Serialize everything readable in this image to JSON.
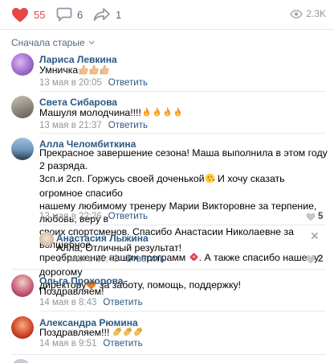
{
  "post_actions": {
    "likes": "55",
    "comments": "6",
    "shares": "1",
    "views": "2.3K"
  },
  "sort_label": "Сначала старые",
  "comments": [
    {
      "author": "Лариса Левкина",
      "text": "Умничка",
      "emoji": [
        "thumbs-up",
        "thumbs-up",
        "thumbs-up"
      ],
      "date": "13 мая в 20:05",
      "reply": "Ответить"
    },
    {
      "author": "Света Сибарова",
      "text": "Машуля молодчина!!!!",
      "emoji": [
        "fire",
        "fire",
        "fire",
        "fire"
      ],
      "date": "13 мая в 21:37",
      "reply": "Ответить"
    },
    {
      "author": "Алла Челомбиткина",
      "lines": [
        "Прекрасное завершение сезона! Маша выполнила в этом году 2 разряда.",
        "3сп.и 2сп. Горжусь своей доченькой",
        "И хочу сказать огромное спасибо",
        "нашему любимому тренеру Марии Викторовне за терпение, любовь, веру в",
        "своих спортсменов. Спасибо Анастасии Николаевне за волшебное",
        "преображение наших программ",
        ". А также спасибо нашему дорогому",
        "директору",
        "за заботу, помощь, поддержку!"
      ],
      "date": "13 мая в 22:26",
      "reply": "Ответить",
      "likes": "5"
    },
    {
      "author": "Анастасия Лыжина",
      "text": "Алла, Отличный результат!",
      "date": "14 мая в 13:42",
      "reply": "Ответить",
      "likes": "2"
    },
    {
      "author": "Ольга Прохорова",
      "text": "Поздравляем!",
      "date": "14 мая в 8:43",
      "reply": "Ответить"
    },
    {
      "author": "Александра Рюмина",
      "text": "Поздравляем!!!",
      "emoji": [
        "clap",
        "clap",
        "clap"
      ],
      "date": "14 мая в 9:51",
      "reply": "Ответить"
    }
  ],
  "colors": {
    "link": "#2a5885",
    "meta": "#939699",
    "like_red": "#e64646",
    "divider": "#e7e8ec"
  }
}
